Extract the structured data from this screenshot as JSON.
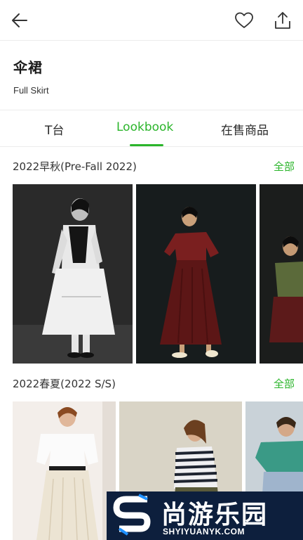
{
  "header": {
    "back_icon": "arrow-left-icon",
    "favorite_icon": "heart-icon",
    "share_icon": "share-icon"
  },
  "item": {
    "title": "伞裙",
    "subtitle": "Full Skirt"
  },
  "tabs": [
    {
      "label": "T台",
      "active": false
    },
    {
      "label": "Lookbook",
      "active": true
    },
    {
      "label": "在售商品",
      "active": false
    }
  ],
  "sections": [
    {
      "title": "2022早秋(Pre-Fall 2022)",
      "all_label": "全部"
    },
    {
      "title": "2022春夏(2022 S/S)",
      "all_label": "全部"
    }
  ],
  "watermark": {
    "text": "尚游乐园",
    "url": "SHYIYUANYK.COM"
  },
  "colors": {
    "accent": "#2bb52b",
    "text": "#222222",
    "watermark_bg": "#0d1f3d"
  }
}
